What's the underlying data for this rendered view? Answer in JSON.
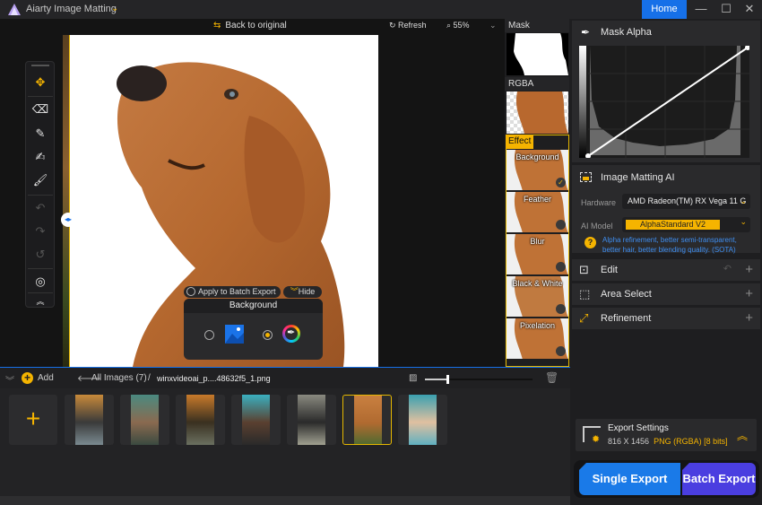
{
  "titlebar": {
    "app_title": "Aiarty Image Matting",
    "home_label": "Home",
    "minimize_glyph": "—",
    "maximize_glyph": "☐",
    "close_glyph": "✕"
  },
  "canvas_toolbar": {
    "back_to_original": "Back to original",
    "refresh": "Refresh",
    "zoom_level": "55%"
  },
  "tools": [
    {
      "name": "move",
      "glyph": "✥"
    },
    {
      "name": "eraser",
      "glyph": "⌫"
    },
    {
      "name": "brush",
      "glyph": "✎"
    },
    {
      "name": "paint",
      "glyph": "✍"
    },
    {
      "name": "roller",
      "glyph": "🖌"
    },
    {
      "name": "undo",
      "glyph": "↶"
    },
    {
      "name": "redo",
      "glyph": "↷"
    },
    {
      "name": "reset",
      "glyph": "↺"
    },
    {
      "name": "fit",
      "glyph": "◎"
    },
    {
      "name": "collapse",
      "glyph": "︽"
    }
  ],
  "popover": {
    "apply_batch": "Apply to Batch Export",
    "hide": "Hide",
    "title": "Background",
    "selected_option": "color"
  },
  "preview": {
    "mask_label": "Mask",
    "rgba_label": "RGBA",
    "effect_label": "Effect",
    "effects": [
      {
        "label": "Background",
        "active": true
      },
      {
        "label": "Feather",
        "active": false
      },
      {
        "label": "Blur",
        "active": false
      },
      {
        "label": "Black & White",
        "active": false
      },
      {
        "label": "Pixelation",
        "active": false
      }
    ]
  },
  "right_panel": {
    "mask_alpha_title": "Mask Alpha",
    "curve": {
      "start": [
        0,
        0
      ],
      "end": [
        1,
        1
      ]
    },
    "matting_title": "Image Matting AI",
    "hardware_label": "Hardware",
    "hardware_value": "AMD Radeon(TM) RX Vega 11 G",
    "model_label": "AI Model",
    "model_value": "AlphaStandard  V2",
    "model_desc": "Alpha refinement, better semi-transparent, better hair, better blending quality. (SOTA)",
    "sections": [
      {
        "title": "Edit"
      },
      {
        "title": "Area Select"
      },
      {
        "title": "Refinement"
      }
    ]
  },
  "export": {
    "settings_title": "Export Settings",
    "dimensions": "816 X 1456",
    "format": "PNG (RGBA) [8 bits]",
    "single_export": "Single Export",
    "batch_export": "Batch Export"
  },
  "bottom": {
    "add_label": "Add",
    "all_images": "All Images (7)",
    "separator": "/",
    "filename": "winxvideoai_p....48632f5_1.png",
    "thumb_size": 0.2,
    "images": [
      {
        "colors": [
          "#c98a3a",
          "#3a3a3a",
          "#7a8a90"
        ]
      },
      {
        "colors": [
          "#4a8a80",
          "#8a6a50",
          "#3a4a40"
        ]
      },
      {
        "colors": [
          "#c97a2a",
          "#3a3020",
          "#6a7060"
        ]
      },
      {
        "colors": [
          "#3ab0c0",
          "#5a4030",
          "#2a2a2a"
        ]
      },
      {
        "colors": [
          "#8a8a80",
          "#2a2a2a",
          "#a0a090"
        ]
      },
      {
        "colors": [
          "#c98040",
          "#b06a30",
          "#4a6a30"
        ],
        "selected": true
      },
      {
        "colors": [
          "#3aa0b0",
          "#e0c0a0",
          "#60b0c0"
        ]
      }
    ]
  }
}
